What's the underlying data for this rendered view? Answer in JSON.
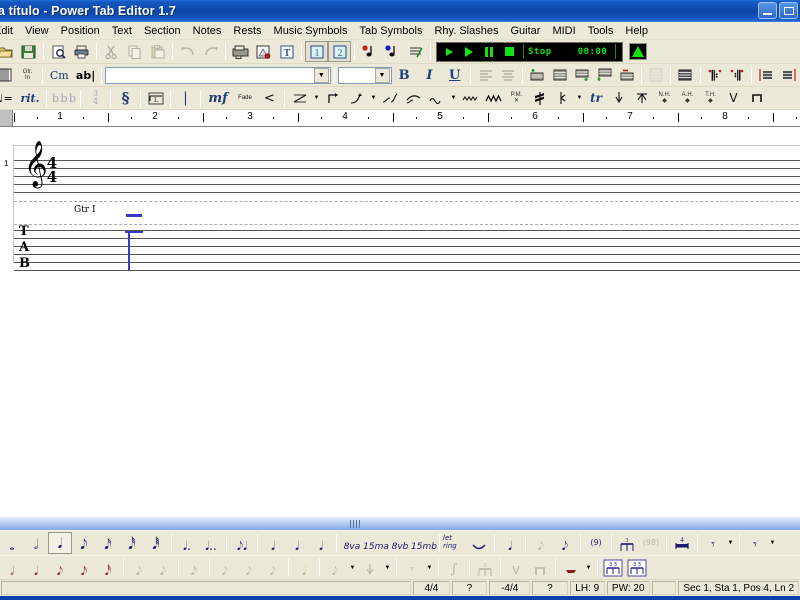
{
  "window": {
    "title": "a título - Power Tab Editor 1.7",
    "controls": [
      "minimize",
      "maximize",
      "close"
    ]
  },
  "menu": {
    "items": [
      {
        "label": "Edit"
      },
      {
        "label": "View"
      },
      {
        "label": "Position"
      },
      {
        "label": "Text"
      },
      {
        "label": "Section"
      },
      {
        "label": "Notes"
      },
      {
        "label": "Rests"
      },
      {
        "label": "Music Symbols"
      },
      {
        "label": "Tab Symbols"
      },
      {
        "label": "Rhy. Slashes"
      },
      {
        "label": "Guitar"
      },
      {
        "label": "MIDI"
      },
      {
        "label": "Tools"
      },
      {
        "label": "Help"
      }
    ]
  },
  "toolbar_main": {
    "icons": [
      "open-icon",
      "save-icon",
      "print-preview-icon",
      "print-icon",
      "cut-icon",
      "copy-icon",
      "paste-icon",
      "undo-icon",
      "redo-icon",
      "file-info-icon",
      "guitar-setup-icon",
      "lyrics-icon",
      "staff-1-icon",
      "staff-2-icon",
      "add-note-icon",
      "remove-note-icon",
      "tuning-icon"
    ]
  },
  "playback": {
    "play_from_start_label": "play-from-beginning",
    "play_label": "play",
    "pause_label": "pause",
    "stop_label": "stop",
    "status": "Stop",
    "time": "00:00",
    "metronome_label": "metronome"
  },
  "toolbar_text": {
    "fretboard_icon": "fretboard-icon",
    "gtr_in_label": "Gtr. In",
    "chord_label": "Cm",
    "text_label": "ab|",
    "font_value": "",
    "font_placeholder": "",
    "size_value": "",
    "bold_label": "B",
    "italic_label": "I",
    "underline_label": "U",
    "align_icons": [
      "align-left-icon",
      "align-center-icon",
      "align-right-icon"
    ],
    "staff_icons": [
      "staff-add-top-icon",
      "staff-full-icon",
      "staff-add-bottom-icon",
      "staff-insert-icon",
      "staff-remove-icon",
      "staff-blank-icon",
      "staff-solid-icon",
      "repeat-start-icon",
      "repeat-end-icon",
      "barline-left-icon",
      "barline-right-icon"
    ]
  },
  "toolbar_symbols": {
    "tempo_label": "♩=",
    "rit_label": "rit.",
    "key_label": "b b b",
    "time_top": "3",
    "time_bottom": "4",
    "segno_label": "segno-icon",
    "repeat_ending_label": "1.",
    "barline_label": "|",
    "dynamic_label": "mf",
    "fade_label": "Fade",
    "crescendo_label": "<",
    "tab_icons": [
      "slide-in-icon",
      "hammer-on-icon",
      "slide-out-icon",
      "bend-icon",
      "vibrato-icon",
      "wide-vibrato-icon",
      "palm-mute-icon",
      "tremolo-picking-icon",
      "tremolo-bar-icon",
      "trill-icon",
      "pick-stroke-down-icon",
      "pick-stroke-up-icon",
      "natural-harmonic-icon",
      "artificial-harmonic-icon",
      "tapped-harmonic-icon",
      "v-stroke-icon",
      "square-stroke-icon"
    ],
    "harmonic_labels": [
      "P.M.",
      "N.H.",
      "A.H.",
      "T.H."
    ]
  },
  "ruler": {
    "numbers": [
      "1",
      "2",
      "3",
      "4",
      "5",
      "6",
      "7",
      "8"
    ]
  },
  "score": {
    "measure_number": "1",
    "clef": "treble-clef",
    "time_signature_top": "4",
    "time_signature_bottom": "4",
    "guitar_label": "Gtr I",
    "tab_letters": [
      "T",
      "A",
      "B"
    ],
    "caret_color": "#3a38c8"
  },
  "toolbar_notes": {
    "durations": [
      "whole-note-icon",
      "half-note-icon",
      "quarter-note-icon",
      "eighth-note-icon",
      "sixteenth-note-icon",
      "thirtysecond-note-icon",
      "sixtyfourth-note-icon"
    ],
    "selected_duration": "quarter-note-icon",
    "dotted": [
      "dotted-note-icon",
      "double-dotted-note-icon"
    ],
    "tied": "tied-note-icon",
    "accents": [
      "accent-icon",
      "marcato-icon",
      "sforzando-icon"
    ],
    "octaves": [
      "8va",
      "15ma",
      "8vb",
      "15mb"
    ],
    "let_ring_label": "let ring",
    "tie_icon": "tie-icon",
    "staccato_icon": "staccato-icon",
    "grace_note_icon": "grace-note-icon",
    "acciaccatura_icon": "acciaccatura-icon",
    "ghost_note_label": "(9)",
    "triplet_label": "3",
    "multibar_label": "(98)",
    "multibar_rest_label": "4",
    "rest_icons": [
      "rest-icon",
      "rest-dropdown-icon"
    ]
  },
  "toolbar_slashes": {
    "slashes": [
      "slash-whole-icon",
      "slash-half-icon",
      "slash-quarter-icon",
      "slash-eighth-icon",
      "slash-sixteenth-icon"
    ],
    "disabled_icons": [
      "slash-dotted-icon",
      "slash-double-dotted-icon",
      "slash-tied-icon",
      "slash-accent-icon",
      "slash-marcato-icon",
      "slash-sforzando-icon",
      "slash-staccato-icon",
      "slash-arpeggio-up-icon",
      "slash-arpeggio-down-icon",
      "slash-rest-icon",
      "slash-pick-icon",
      "slash-triplet-icon",
      "slash-v-icon",
      "slash-square-icon"
    ],
    "active_icons": [
      "slash-tremolo-icon",
      "slash-triplet-feel-1-icon",
      "slash-triplet-feel-2-icon"
    ]
  },
  "statusbar": {
    "panels": [
      {
        "text": ""
      },
      {
        "text": "4/4"
      },
      {
        "text": "?"
      },
      {
        "text": "-4/4"
      },
      {
        "text": "?"
      },
      {
        "text": "LH: 9"
      },
      {
        "text": "PW: 20"
      },
      {
        "text": ""
      },
      {
        "text": "Sec 1, Sta 1, Pos 4, Ln 2"
      }
    ]
  }
}
